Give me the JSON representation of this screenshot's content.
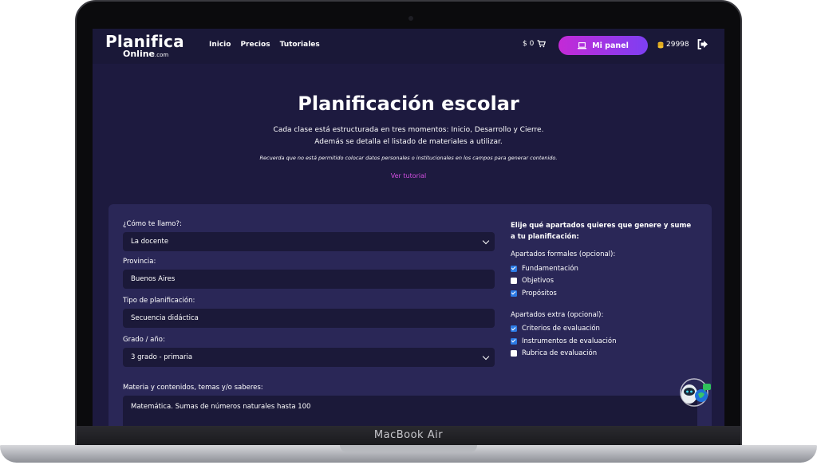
{
  "device": {
    "label": "MacBook Air"
  },
  "nav": {
    "logo_main": "Planifica",
    "logo_sub": "Online",
    "logo_suffix": ".com",
    "links": [
      "Inicio",
      "Precios",
      "Tutoriales"
    ],
    "cart_amount": "$ 0",
    "panel_button": "Mi panel",
    "credits": "29998"
  },
  "hero": {
    "title": "Planificación escolar",
    "desc_line1": "Cada clase está estructurada en tres momentos: Inicio, Desarrollo y Cierre.",
    "desc_line2": "Además se detalla el listado de materiales a utilizar.",
    "note": "Recuerda que no está permitido colocar datos personales o institucionales en los campos para generar contenido.",
    "tutorial_link": "Ver tutorial"
  },
  "form": {
    "name_label": "¿Cómo te llamo?:",
    "name_value": "La docente",
    "province_label": "Provincia:",
    "province_value": "Buenos Aires",
    "type_label": "Tipo de planificación:",
    "type_value": "Secuencia didáctica",
    "grade_label": "Grado / año:",
    "grade_value": "3 grado - primaria",
    "subject_label": "Materia y contenidos, temas y/o saberes:",
    "subject_value": "Matemática. Sumas de números naturales hasta 100"
  },
  "sections": {
    "title": "Elije qué apartados quieres que genere y sume a tu planificación:",
    "formal_label": "Apartados formales (opcional):",
    "formal": [
      {
        "label": "Fundamentación",
        "checked": true
      },
      {
        "label": "Objetivos",
        "checked": false
      },
      {
        "label": "Propósitos",
        "checked": true
      }
    ],
    "extra_label": "Apartados extra (opcional):",
    "extra": [
      {
        "label": "Criterios de evaluación",
        "checked": true
      },
      {
        "label": "Instrumentos de evaluación",
        "checked": true
      },
      {
        "label": "Rubrica de evaluación",
        "checked": false
      }
    ]
  },
  "colors": {
    "page_bg": "#1d1a3f",
    "card_bg": "#2a2757",
    "accent_gradient_start": "#c42ad6",
    "accent_gradient_end": "#7d3ff2",
    "link": "#d14fe0",
    "checkbox_on": "#2c7be5"
  },
  "icons": [
    "cart-icon",
    "laptop-icon",
    "coins-icon",
    "logout-icon",
    "chevron-down-icon",
    "chatbot-icon"
  ]
}
